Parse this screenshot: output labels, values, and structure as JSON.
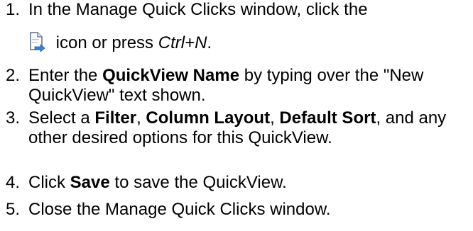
{
  "steps": [
    {
      "number": "1.",
      "before_icon": "In the Manage Quick Clicks window, click the",
      "icon": "new-document-icon",
      "after_icon": " icon or press ",
      "shortcut": "Ctrl+N",
      "end": "."
    },
    {
      "number": "2.",
      "pre": "Enter the ",
      "bold": "QuickView Name",
      "post": " by typing over the \"New QuickView\" text shown."
    },
    {
      "number": "3.",
      "pre": "Select a ",
      "bold1": "Filter",
      "sep1": ", ",
      "bold2": "Column Layout",
      "sep2": ", ",
      "bold3": "Default Sort",
      "post": ", and any other desired options for this QuickView."
    },
    {
      "number": "4.",
      "pre": "Click ",
      "bold": "Save",
      "post": " to save the QuickView."
    },
    {
      "number": "5.",
      "text": "Close the Manage Quick Clicks window."
    }
  ],
  "colors": {
    "text": "#000000",
    "icon_page": "#ffffff",
    "icon_outline": "#5a6e8c",
    "icon_arrow": "#3a7fd0"
  }
}
